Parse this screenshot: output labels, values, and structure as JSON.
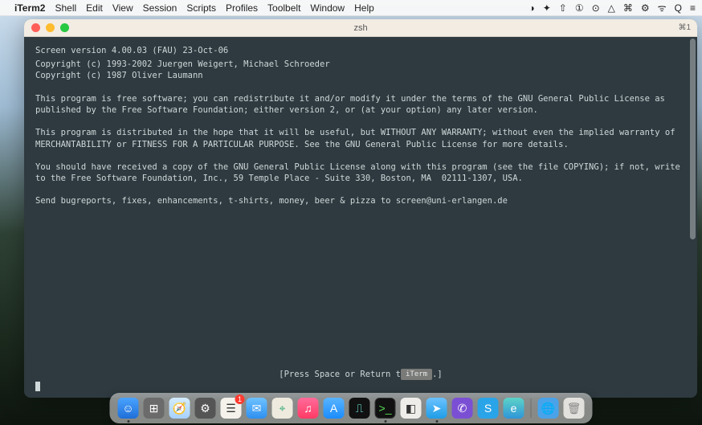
{
  "menubar": {
    "app": "iTerm2",
    "items": [
      "Shell",
      "Edit",
      "View",
      "Session",
      "Scripts",
      "Profiles",
      "Toolbelt",
      "Window",
      "Help"
    ],
    "status": [
      "◑",
      "✦",
      "⇧",
      "①",
      "⊙",
      "△",
      "⌘",
      "⚙",
      "ᯤ",
      "Q",
      "≡"
    ]
  },
  "window": {
    "title": "zsh",
    "corner": "⌘1"
  },
  "terminal": {
    "lines": [
      "Screen version 4.00.03 (FAU) 23-Oct-06",
      "Copyright (c) 1993-2002 Juergen Weigert, Michael Schroeder",
      "Copyright (c) 1987 Oliver Laumann",
      "This program is free software; you can redistribute it and/or modify it under the terms of the GNU General Public License as published by the Free Software Foundation; either version 2, or (at your option) any later version.",
      "This program is distributed in the hope that it will be useful, but WITHOUT ANY WARRANTY; without even the implied warranty of MERCHANTABILITY or FITNESS FOR A PARTICULAR PURPOSE. See the GNU General Public License for more details.",
      "You should have received a copy of the GNU General Public License along with this program (see the file COPYING); if not, write to the Free Software Foundation, Inc., 59 Temple Place - Suite 330, Boston, MA  02111-1307, USA.",
      "Send bugreports, fixes, enhancements, t-shirts, money, beer & pizza to screen@uni-erlangen.de"
    ],
    "status_prefix": "[Press Space or Return t",
    "status_badge": "iTerm",
    "status_suffix": ".]"
  },
  "dock": {
    "items": [
      {
        "name": "finder",
        "glyph": "☺",
        "cls": "di-finder",
        "running": true
      },
      {
        "name": "launchpad",
        "glyph": "⊞",
        "cls": "di-launch"
      },
      {
        "name": "safari",
        "glyph": "🧭",
        "cls": "di-safari"
      },
      {
        "name": "settings",
        "glyph": "⚙",
        "cls": "di-settings"
      },
      {
        "name": "reminders",
        "glyph": "☰",
        "cls": "di-reminders",
        "badge": "1"
      },
      {
        "name": "mail",
        "glyph": "✉",
        "cls": "di-mail"
      },
      {
        "name": "maps",
        "glyph": "⌖",
        "cls": "di-maps"
      },
      {
        "name": "music",
        "glyph": "♫",
        "cls": "di-music"
      },
      {
        "name": "appstore",
        "glyph": "A",
        "cls": "di-appstore"
      },
      {
        "name": "activity",
        "glyph": "⎍",
        "cls": "di-activity"
      },
      {
        "name": "iterm",
        "glyph": ">_",
        "cls": "di-iterm",
        "running": true
      },
      {
        "name": "app1",
        "glyph": "◧",
        "cls": "di-generic"
      },
      {
        "name": "telegram",
        "glyph": "➤",
        "cls": "di-telegram",
        "running": true
      },
      {
        "name": "viber",
        "glyph": "✆",
        "cls": "di-viber"
      },
      {
        "name": "skype",
        "glyph": "S",
        "cls": "di-skype"
      },
      {
        "name": "edge",
        "glyph": "e",
        "cls": "di-edge"
      },
      {
        "sep": true
      },
      {
        "name": "globe",
        "glyph": "🌐",
        "cls": "di-globe"
      },
      {
        "name": "trash",
        "glyph": "🗑",
        "cls": "di-trash"
      }
    ]
  }
}
